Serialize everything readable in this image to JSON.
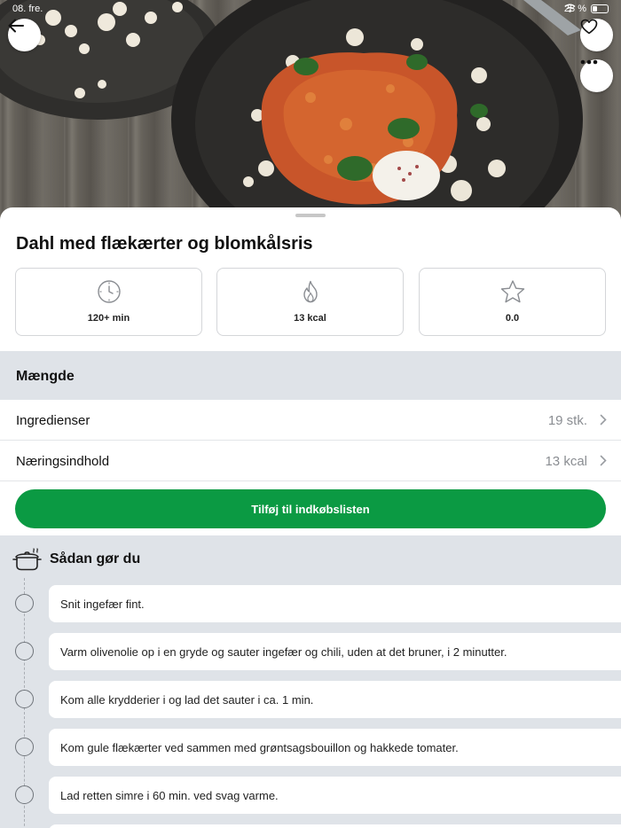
{
  "status_bar": {
    "time": "08.",
    "day": "fre.",
    "battery": "28 %"
  },
  "hero": {
    "partial_title": "..."
  },
  "recipe": {
    "title": "Dahl med flækærter og blomkålsris",
    "stats": {
      "time": {
        "icon": "clock-icon",
        "value": "120+ min"
      },
      "energy": {
        "icon": "flame-icon",
        "value": "13 kcal"
      },
      "rating": {
        "icon": "star-icon",
        "value": "0.0"
      }
    }
  },
  "amount_section": {
    "title": "Mængde",
    "rows": [
      {
        "label": "Ingredienser",
        "value": "19 stk."
      },
      {
        "label": "Næringsindhold",
        "value": "13 kcal"
      }
    ]
  },
  "cta": {
    "label": "Tilføj til indkøbslisten",
    "color": "#0b9a43"
  },
  "steps_section": {
    "title": "Sådan gør du",
    "icon": "cooking-pot-icon",
    "steps": [
      "Snit ingefær fint.",
      "Varm olivenolie op i en gryde og sauter ingefær og chili, uden at det bruner, i 2 minutter.",
      "Kom alle krydderier i og lad det sauter i ca. 1 min.",
      "Kom gule flækærter ved sammen med grøntsagsbouillon og hakkede tomater.",
      "Lad retten simre i 60 min. ved svag varme."
    ]
  }
}
